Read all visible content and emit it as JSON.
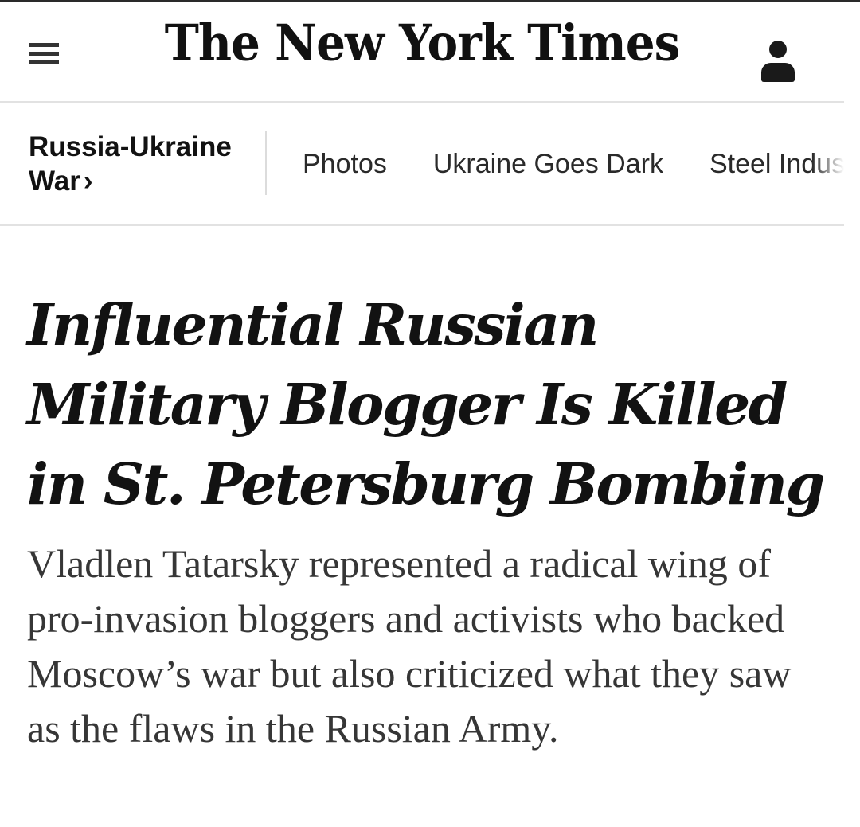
{
  "masthead": {
    "logo": "The New York Times",
    "menu_icon": "hamburger-menu-icon",
    "account_icon": "account-person-icon"
  },
  "section_nav": {
    "section": "Russia-Ukraine War",
    "section_chevron": "›",
    "links": [
      "Photos",
      "Ukraine Goes Dark",
      "Steel Industry"
    ]
  },
  "article": {
    "headline": "Influential Russian Military Blogger Is Killed in St. Petersburg Bombing",
    "summary": "Vladlen Tatarsky represented a radical wing of pro-invasion bloggers and activists who backed Moscow’s war but also criticized what they saw as the flaws in the Russian Army."
  },
  "colors": {
    "text": "#121212",
    "summary_text": "#363636",
    "divider": "#e2e2e2"
  }
}
